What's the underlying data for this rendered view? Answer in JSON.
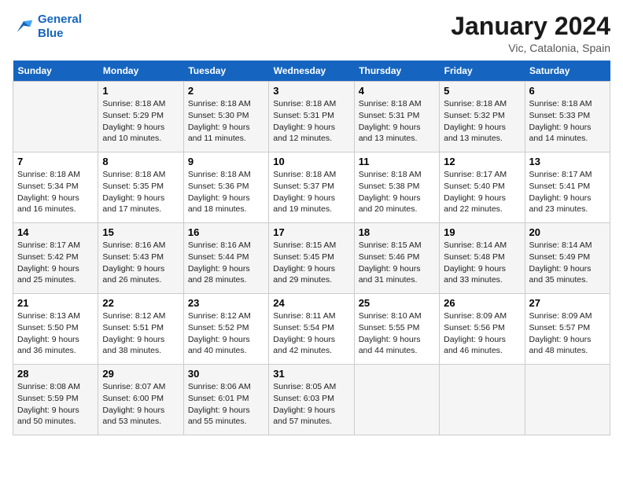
{
  "logo": {
    "line1": "General",
    "line2": "Blue"
  },
  "title": "January 2024",
  "subtitle": "Vic, Catalonia, Spain",
  "weekdays": [
    "Sunday",
    "Monday",
    "Tuesday",
    "Wednesday",
    "Thursday",
    "Friday",
    "Saturday"
  ],
  "weeks": [
    [
      {
        "day": "",
        "info": ""
      },
      {
        "day": "1",
        "info": "Sunrise: 8:18 AM\nSunset: 5:29 PM\nDaylight: 9 hours\nand 10 minutes."
      },
      {
        "day": "2",
        "info": "Sunrise: 8:18 AM\nSunset: 5:30 PM\nDaylight: 9 hours\nand 11 minutes."
      },
      {
        "day": "3",
        "info": "Sunrise: 8:18 AM\nSunset: 5:31 PM\nDaylight: 9 hours\nand 12 minutes."
      },
      {
        "day": "4",
        "info": "Sunrise: 8:18 AM\nSunset: 5:31 PM\nDaylight: 9 hours\nand 13 minutes."
      },
      {
        "day": "5",
        "info": "Sunrise: 8:18 AM\nSunset: 5:32 PM\nDaylight: 9 hours\nand 13 minutes."
      },
      {
        "day": "6",
        "info": "Sunrise: 8:18 AM\nSunset: 5:33 PM\nDaylight: 9 hours\nand 14 minutes."
      }
    ],
    [
      {
        "day": "7",
        "info": "Sunrise: 8:18 AM\nSunset: 5:34 PM\nDaylight: 9 hours\nand 16 minutes."
      },
      {
        "day": "8",
        "info": "Sunrise: 8:18 AM\nSunset: 5:35 PM\nDaylight: 9 hours\nand 17 minutes."
      },
      {
        "day": "9",
        "info": "Sunrise: 8:18 AM\nSunset: 5:36 PM\nDaylight: 9 hours\nand 18 minutes."
      },
      {
        "day": "10",
        "info": "Sunrise: 8:18 AM\nSunset: 5:37 PM\nDaylight: 9 hours\nand 19 minutes."
      },
      {
        "day": "11",
        "info": "Sunrise: 8:18 AM\nSunset: 5:38 PM\nDaylight: 9 hours\nand 20 minutes."
      },
      {
        "day": "12",
        "info": "Sunrise: 8:17 AM\nSunset: 5:40 PM\nDaylight: 9 hours\nand 22 minutes."
      },
      {
        "day": "13",
        "info": "Sunrise: 8:17 AM\nSunset: 5:41 PM\nDaylight: 9 hours\nand 23 minutes."
      }
    ],
    [
      {
        "day": "14",
        "info": "Sunrise: 8:17 AM\nSunset: 5:42 PM\nDaylight: 9 hours\nand 25 minutes."
      },
      {
        "day": "15",
        "info": "Sunrise: 8:16 AM\nSunset: 5:43 PM\nDaylight: 9 hours\nand 26 minutes."
      },
      {
        "day": "16",
        "info": "Sunrise: 8:16 AM\nSunset: 5:44 PM\nDaylight: 9 hours\nand 28 minutes."
      },
      {
        "day": "17",
        "info": "Sunrise: 8:15 AM\nSunset: 5:45 PM\nDaylight: 9 hours\nand 29 minutes."
      },
      {
        "day": "18",
        "info": "Sunrise: 8:15 AM\nSunset: 5:46 PM\nDaylight: 9 hours\nand 31 minutes."
      },
      {
        "day": "19",
        "info": "Sunrise: 8:14 AM\nSunset: 5:48 PM\nDaylight: 9 hours\nand 33 minutes."
      },
      {
        "day": "20",
        "info": "Sunrise: 8:14 AM\nSunset: 5:49 PM\nDaylight: 9 hours\nand 35 minutes."
      }
    ],
    [
      {
        "day": "21",
        "info": "Sunrise: 8:13 AM\nSunset: 5:50 PM\nDaylight: 9 hours\nand 36 minutes."
      },
      {
        "day": "22",
        "info": "Sunrise: 8:12 AM\nSunset: 5:51 PM\nDaylight: 9 hours\nand 38 minutes."
      },
      {
        "day": "23",
        "info": "Sunrise: 8:12 AM\nSunset: 5:52 PM\nDaylight: 9 hours\nand 40 minutes."
      },
      {
        "day": "24",
        "info": "Sunrise: 8:11 AM\nSunset: 5:54 PM\nDaylight: 9 hours\nand 42 minutes."
      },
      {
        "day": "25",
        "info": "Sunrise: 8:10 AM\nSunset: 5:55 PM\nDaylight: 9 hours\nand 44 minutes."
      },
      {
        "day": "26",
        "info": "Sunrise: 8:09 AM\nSunset: 5:56 PM\nDaylight: 9 hours\nand 46 minutes."
      },
      {
        "day": "27",
        "info": "Sunrise: 8:09 AM\nSunset: 5:57 PM\nDaylight: 9 hours\nand 48 minutes."
      }
    ],
    [
      {
        "day": "28",
        "info": "Sunrise: 8:08 AM\nSunset: 5:59 PM\nDaylight: 9 hours\nand 50 minutes."
      },
      {
        "day": "29",
        "info": "Sunrise: 8:07 AM\nSunset: 6:00 PM\nDaylight: 9 hours\nand 53 minutes."
      },
      {
        "day": "30",
        "info": "Sunrise: 8:06 AM\nSunset: 6:01 PM\nDaylight: 9 hours\nand 55 minutes."
      },
      {
        "day": "31",
        "info": "Sunrise: 8:05 AM\nSunset: 6:03 PM\nDaylight: 9 hours\nand 57 minutes."
      },
      {
        "day": "",
        "info": ""
      },
      {
        "day": "",
        "info": ""
      },
      {
        "day": "",
        "info": ""
      }
    ]
  ]
}
